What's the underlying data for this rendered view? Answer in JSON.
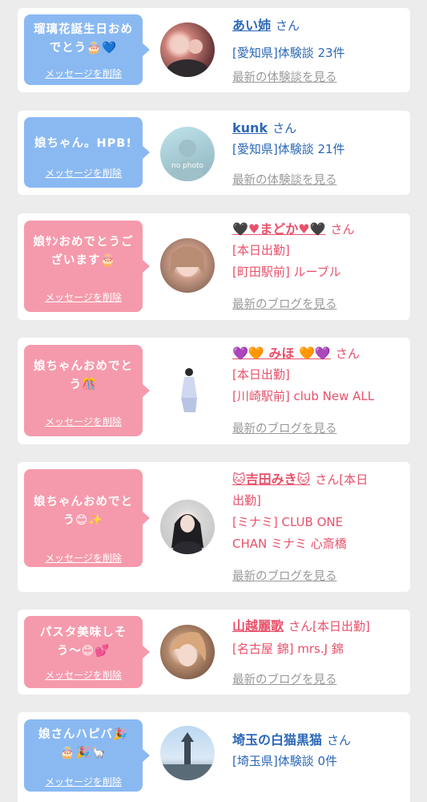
{
  "delete_label": "メッセージを削除",
  "cards": [
    {
      "msg_lines": [
        "瑠璃花誕生日おめ",
        "でとう🎂💙"
      ],
      "name": "あい姉",
      "san": "さん",
      "lines": [
        "[愛知県]体験談 23件"
      ],
      "link": "最新の体験談を見る"
    },
    {
      "msg_lines": [
        "娘ちゃん。HPB!"
      ],
      "name": "kunk",
      "san": "さん",
      "lines": [
        "[愛知県]体験談 21件"
      ],
      "link": "最新の体験談を見る",
      "avatar_text": "no photo"
    },
    {
      "msg_lines": [
        "娘ｻﾝおめでとうご",
        "ざいます🎂"
      ],
      "name": "🖤♥まどか♥🖤",
      "san": "さん",
      "lines": [
        "[本日出勤]",
        "[町田駅前] ルーブル"
      ],
      "link": "最新のブログを見る"
    },
    {
      "msg_lines": [
        "娘ちゃんおめでと",
        "う🎊"
      ],
      "name": "💜🧡 みほ 🧡💜",
      "san": "さん",
      "lines": [
        "[本日出勤]",
        "[川崎駅前] club New ALL"
      ],
      "link": "最新のブログを見る"
    },
    {
      "msg_lines": [
        "娘ちゃんおめでと",
        "う😊✨"
      ],
      "name": "🐱吉田みき🐱",
      "san": "さん[本日",
      "lines": [
        "出勤]",
        "[ミナミ] CLUB ONE",
        "CHAN ミナミ 心斎橋"
      ],
      "link": "最新のブログを見る"
    },
    {
      "msg_lines": [
        "パスタ美味しそ",
        "う〜😊💕"
      ],
      "name": "山越麗歌",
      "san": "さん[本日出勤]",
      "lines": [
        "[名古屋 錦] mrs.J 錦"
      ],
      "link": "最新のブログを見る"
    },
    {
      "msg_lines": [
        "娘さんハピバ🎉",
        "🎂🎉🦙"
      ],
      "name": "埼玉の白猫黒猫",
      "san": "さん",
      "lines": [
        "[埼玉県]体験談 0件"
      ],
      "link": ""
    }
  ],
  "colors": {
    "blue_bubble": "#8ab9f2",
    "pink_bubble": "#f59aac",
    "blue_text": "#2b67b8",
    "red_text": "#e8506a"
  }
}
